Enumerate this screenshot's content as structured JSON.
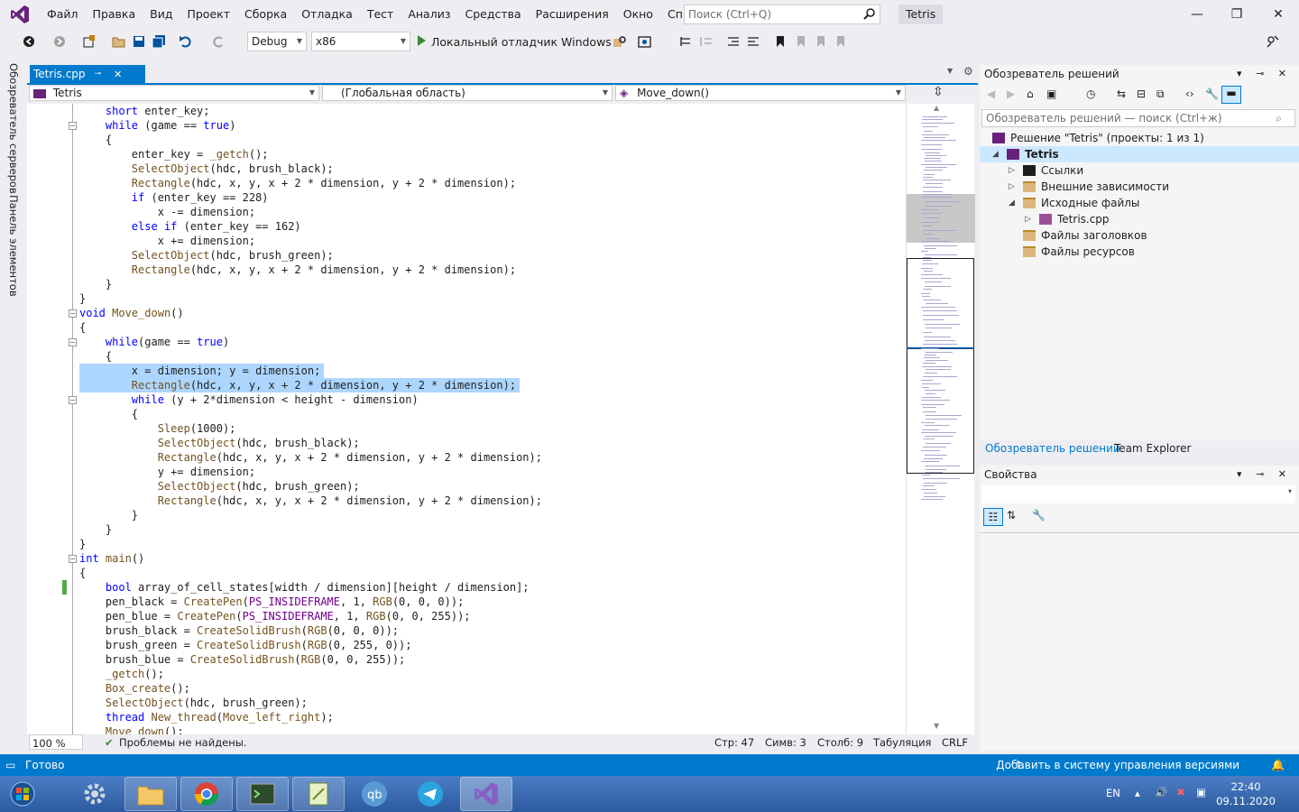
{
  "menubar": {
    "items": [
      "Файл",
      "Правка",
      "Вид",
      "Проект",
      "Сборка",
      "Отладка",
      "Тест",
      "Анализ",
      "Средства",
      "Расширения",
      "Окно",
      "Справка"
    ],
    "search_placeholder": "Поиск (Ctrl+Q)",
    "solution_name": "Tetris"
  },
  "toolbar": {
    "configuration": "Debug",
    "platform": "x86",
    "run_label": "Локальный отладчик Windows"
  },
  "left_tabs": [
    "Обозреватель серверов",
    "Панель элементов"
  ],
  "editor": {
    "tab_label": "Tetris.cpp",
    "nav_project": "Tetris",
    "nav_scope": "(Глобальная область)",
    "nav_member": "Move_down()",
    "lines": [
      "    short enter_key;",
      "    while (game == true)",
      "    {",
      "        enter_key = _getch();",
      "        SelectObject(hdc, brush_black);",
      "        Rectangle(hdc, x, y, x + 2 * dimension, y + 2 * dimension);",
      "        if (enter_key == 228)",
      "            x -= dimension;",
      "        else if (enter_key == 162)",
      "            x += dimension;",
      "        SelectObject(hdc, brush_green);",
      "        Rectangle(hdc, x, y, x + 2 * dimension, y + 2 * dimension);",
      "    }",
      "}",
      "void Move_down()",
      "{",
      "    while(game == true)",
      "    {",
      "        x = dimension; y = dimension;",
      "        Rectangle(hdc, x, y, x + 2 * dimension, y + 2 * dimension);",
      "        while (y + 2*dimension < height - dimension)",
      "        {",
      "            Sleep(1000);",
      "            SelectObject(hdc, brush_black);",
      "            Rectangle(hdc, x, y, x + 2 * dimension, y + 2 * dimension);",
      "            y += dimension;",
      "            SelectObject(hdc, brush_green);",
      "            Rectangle(hdc, x, y, x + 2 * dimension, y + 2 * dimension);",
      "        }",
      "    }",
      "}",
      "int main()",
      "{",
      "    bool array_of_cell_states[width / dimension][height / dimension];",
      "    pen_black = CreatePen(PS_INSIDEFRAME, 1, RGB(0, 0, 0));",
      "    pen_blue = CreatePen(PS_INSIDEFRAME, 1, RGB(0, 0, 255));",
      "    brush_black = CreateSolidBrush(RGB(0, 0, 0));",
      "    brush_green = CreateSolidBrush(RGB(0, 255, 0));",
      "    brush_blue = CreateSolidBrush(RGB(0, 0, 255));",
      "    _getch();",
      "    Box_create();",
      "    SelectObject(hdc, brush_green);",
      "    thread New_thread(Move_left_right);",
      "    Move_down();"
    ],
    "status": {
      "zoom": "100 %",
      "problems": "Проблемы не найдены.",
      "line": "Стр: 47",
      "char": "Симв: 3",
      "col": "Столб: 9",
      "indent": "Табуляция",
      "eol": "CRLF"
    }
  },
  "solution_explorer": {
    "title": "Обозреватель решений",
    "search_placeholder": "Обозреватель решений — поиск (Ctrl+ж)",
    "tree": [
      {
        "label": "Решение \"Tetris\" (проекты: 1 из 1)",
        "level": 0,
        "expander": "",
        "icon": "solution-icon"
      },
      {
        "label": "Tetris",
        "level": 0,
        "expander": "expanded",
        "icon": "project-icon",
        "selected": true
      },
      {
        "label": "Ссылки",
        "level": 1,
        "expander": "collapsed",
        "icon": "references-icon"
      },
      {
        "label": "Внешние зависимости",
        "level": 1,
        "expander": "collapsed",
        "icon": "folder-icon"
      },
      {
        "label": "Исходные файлы",
        "level": 1,
        "expander": "expanded",
        "icon": "folder-icon"
      },
      {
        "label": "Tetris.cpp",
        "level": 2,
        "expander": "collapsed",
        "icon": "cpp-file-icon"
      },
      {
        "label": "Файлы заголовков",
        "level": 1,
        "expander": "",
        "icon": "folder-icon"
      },
      {
        "label": "Файлы ресурсов",
        "level": 1,
        "expander": "",
        "icon": "folder-icon"
      }
    ],
    "tabs": [
      "Обозреватель решений",
      "Team Explorer"
    ]
  },
  "properties": {
    "title": "Свойства"
  },
  "statusbar": {
    "ready": "Готово",
    "vcs": "Добавить в систему управления версиями"
  },
  "taskbar": {
    "lang": "EN",
    "time": "22:40",
    "date": "09.11.2020"
  },
  "colors": {
    "accent": "#007acc",
    "selection": "#add6ff",
    "keyword": "#0000ff"
  }
}
